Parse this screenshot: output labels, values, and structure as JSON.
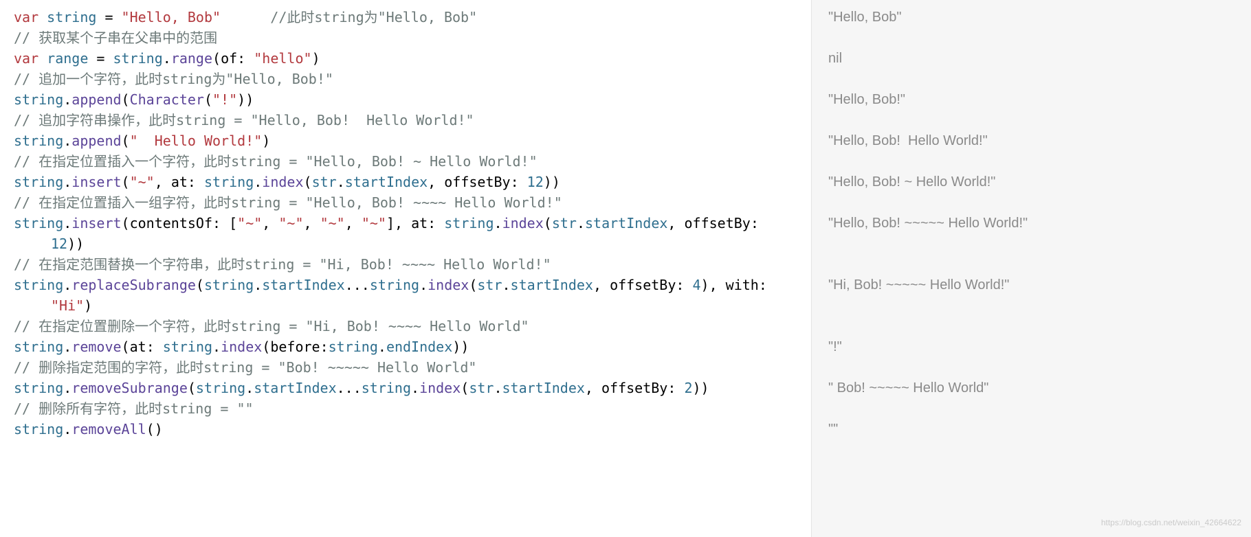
{
  "code": {
    "l1": {
      "kw_var": "var",
      "id": "string",
      "eq": " = ",
      "str": "\"Hello, Bob\"",
      "pad": "      ",
      "comment": "//此时string为\"Hello, Bob\""
    },
    "l2": {
      "comment": "// 获取某个子串在父串中的范围"
    },
    "l3": {
      "kw_var": "var",
      "id": "range",
      "eq": " = ",
      "obj": "string",
      "dot": ".",
      "method": "range",
      "open": "(",
      "label": "of",
      "colon": ": ",
      "str": "\"hello\"",
      "close": ")"
    },
    "l4": {
      "comment": "// 追加一个字符，此时string为\"Hello, Bob!\""
    },
    "l5": {
      "obj": "string",
      "dot": ".",
      "method": "append",
      "open": "(",
      "type": "Character",
      "open2": "(",
      "str": "\"!\"",
      "close2": ")",
      "close": ")"
    },
    "l6": {
      "comment": "// 追加字符串操作，此时string = \"Hello, Bob!  Hello World!\""
    },
    "l7": {
      "obj": "string",
      "dot": ".",
      "method": "append",
      "open": "(",
      "str": "\"  Hello World!\"",
      "close": ")"
    },
    "l8": {
      "comment": "// 在指定位置插入一个字符，此时string = \"Hello, Bob! ~ Hello World!\""
    },
    "l9": {
      "obj": "string",
      "dot": ".",
      "method": "insert",
      "open": "(",
      "str": "\"~\"",
      "comma": ", ",
      "label_at": "at",
      "colon": ": ",
      "obj2": "string",
      "dot2": ".",
      "method2": "index",
      "open2": "(",
      "obj3": "str",
      "dot3": ".",
      "prop": "startIndex",
      "comma2": ", ",
      "label_off": "offsetBy",
      "colon2": ": ",
      "num": "12",
      "close2": ")",
      "close": ")"
    },
    "l10": {
      "comment": "// 在指定位置插入一组字符，此时string = \"Hello, Bob! ~~~~ Hello World!\""
    },
    "l11a": {
      "obj": "string",
      "dot": ".",
      "method": "insert",
      "open": "(",
      "label_c": "contentsOf",
      "colon": ": ",
      "br_open": "[",
      "s1": "\"~\"",
      "c1": ", ",
      "s2": "\"~\"",
      "c2": ", ",
      "s3": "\"~\"",
      "c3": ", ",
      "s4": "\"~\"",
      "br_close": "]",
      "comma": ", ",
      "label_at": "at",
      "colon2": ": ",
      "obj2": "string",
      "dot2": ".",
      "method2": "index",
      "open2": "(",
      "obj3": "str",
      "dot3": ".",
      "prop": "startIndex",
      "comma2": ", ",
      "label_off": "offsetBy",
      "colon3": ":"
    },
    "l11b": {
      "num": "12",
      "close2": ")",
      "close": ")"
    },
    "l12": {
      "comment": "// 在指定范围替换一个字符串，此时string = \"Hi, Bob! ~~~~ Hello World!\""
    },
    "l13a": {
      "obj": "string",
      "dot": ".",
      "method": "replaceSubrange",
      "open": "(",
      "obj2": "string",
      "dot2": ".",
      "prop1": "startIndex",
      "range": "...",
      "obj3": "string",
      "dot3": ".",
      "method2": "index",
      "open2": "(",
      "obj4": "str",
      "dot4": ".",
      "prop2": "startIndex",
      "comma": ", ",
      "label_off": "offsetBy",
      "colon": ": ",
      "num": "4",
      "close2": ")",
      "comma2": ", ",
      "label_with": "with",
      "colon2": ":"
    },
    "l13b": {
      "str": "\"Hi\"",
      "close": ")"
    },
    "l14": {
      "comment": "// 在指定位置删除一个字符，此时string = \"Hi, Bob! ~~~~ Hello World\""
    },
    "l15": {
      "obj": "string",
      "dot": ".",
      "method": "remove",
      "open": "(",
      "label_at": "at",
      "colon": ": ",
      "obj2": "string",
      "dot2": ".",
      "method2": "index",
      "open2": "(",
      "label_before": "before",
      "colon2": ":",
      "obj3": "string",
      "dot3": ".",
      "prop": "endIndex",
      "close2": ")",
      "close": ")"
    },
    "l16": {
      "comment": "// 删除指定范围的字符，此时string = \"Bob! ~~~~~ Hello World\""
    },
    "l17": {
      "obj": "string",
      "dot": ".",
      "method": "removeSubrange",
      "open": "(",
      "obj2": "string",
      "dot2": ".",
      "prop1": "startIndex",
      "range": "...",
      "obj3": "string",
      "dot3": ".",
      "method2": "index",
      "open2": "(",
      "obj4": "str",
      "dot4": ".",
      "prop2": "startIndex",
      "comma": ", ",
      "label_off": "offsetBy",
      "colon": ": ",
      "num": "2",
      "close2": ")",
      "close": ")"
    },
    "l18": {
      "comment": "// 删除所有字符，此时string = \"\""
    },
    "l19": {
      "obj": "string",
      "dot": ".",
      "method": "removeAll",
      "open": "(",
      "close": ")"
    }
  },
  "results": {
    "r1": "\"Hello, Bob\"",
    "r2": "",
    "r3": "nil",
    "r4": "",
    "r5": "\"Hello, Bob!\"",
    "r6": "",
    "r7": "\"Hello, Bob!  Hello World!\"",
    "r8": "",
    "r9": "\"Hello, Bob! ~ Hello World!\"",
    "r10": "",
    "r11": "\"Hello, Bob! ~~~~~ Hello World!\"",
    "r11b": "",
    "r12": "",
    "r13": "\"Hi, Bob! ~~~~~ Hello World!\"",
    "r13b": "",
    "r14": "",
    "r15": "\"!\"",
    "r16": "",
    "r17": "\" Bob! ~~~~~ Hello World\"",
    "r18": "",
    "r19": "\"\""
  },
  "watermark": "https://blog.csdn.net/weixin_42664622"
}
